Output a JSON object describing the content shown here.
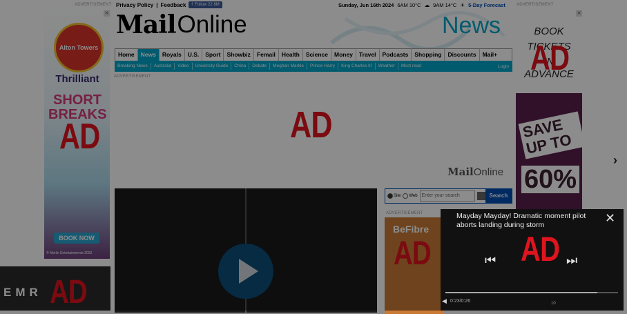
{
  "header": {
    "ad_label_left": "ADVERTISEMENT",
    "ad_label_right": "ADVERTISEMENT",
    "privacy": "Privacy Policy",
    "feedback": "Feedback",
    "facebook": "Follow 22.6M",
    "date": "Sunday, Jun 16th 2024",
    "weather1": "6AM 10°C",
    "weather2": "9AM 14°C",
    "forecast": "5-Day Forecast",
    "logo_mail": "Mail",
    "logo_online": "Online",
    "section": "News"
  },
  "nav": {
    "items": [
      "Home",
      "News",
      "Royals",
      "U.S.",
      "Sport",
      "Showbiz",
      "Femail",
      "Health",
      "Science",
      "Money",
      "Travel",
      "Podcasts",
      "Shopping",
      "Discounts",
      "Mail+"
    ]
  },
  "subnav": {
    "items": [
      "Breaking News",
      "Australia",
      "Video",
      "University Guide",
      "China",
      "Debate",
      "Meghan Markle",
      "Prince Harry",
      "King Charles III",
      "Weather",
      "Most read"
    ],
    "login": "Login"
  },
  "ads": {
    "ad_text": "AD",
    "below_nav_label": "ADVERTISEMENT",
    "mid_mark_mail": "Mail",
    "mid_mark_online": "Online",
    "left": {
      "brand": "Alton Towers",
      "line1": "Thrilliant",
      "line2": "SHORT BREAKS",
      "book": "BOOK NOW",
      "copy": "© Merlin Entertainments 2023"
    },
    "right": {
      "line1": "BOOK",
      "line2": "TICKETS",
      "line3": "IN",
      "line4": "ADVANCE",
      "save": "SAVE UP TO",
      "pct": "60%"
    },
    "side": {
      "label": "ADVERTISEMENT",
      "brand": "BeFibre"
    },
    "bottom": {
      "text": "EMR"
    }
  },
  "search": {
    "opt_site": "Site",
    "opt_web": "Web",
    "placeholder": "Enter your search",
    "button": "Search"
  },
  "floating_video": {
    "title": "Mayday Mayday! Dramatic moment pilot aborts landing during storm",
    "time": "0:23/0:26",
    "progress": 0.88,
    "cc": "10"
  }
}
